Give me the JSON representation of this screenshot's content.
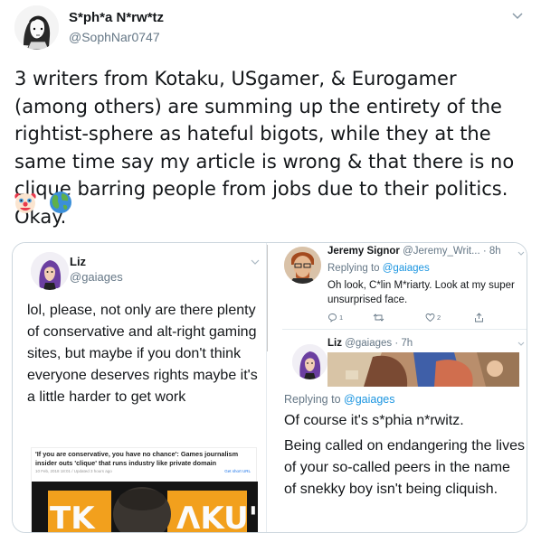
{
  "tweet": {
    "author_name": "S*ph*a N*rw*tz",
    "author_handle": "@SophNar0747",
    "text": "3 writers from Kotaku, USgamer, & Eurogamer (among others) are summing up the entirety of the rightist-sphere as hateful bigots, while they at the same time say my article is wrong & that there is no clique barring people from jobs due to their politics. Okay.",
    "emojis": [
      "clown-face-icon",
      "globe-icon"
    ]
  },
  "media": {
    "left": {
      "name": "Liz",
      "handle": "@gaiages",
      "text": "lol, please, not only are there plenty of conservative and alt-right gaming sites, but maybe if you don't think everyone deserves rights maybe it's a little harder to get work",
      "article": {
        "title": "'If you are conservative, you have no chance': Games journalism insider outs 'clique' that runs industry like private domain",
        "meta": "10 Feb, 2018 18:01 / Updated 3 hours ago",
        "share": "Get short URL",
        "logo_text": "TKOTAKU"
      }
    },
    "right": {
      "reply1": {
        "name": "Jeremy Signor",
        "handle_time": "@Jeremy_Writ... · 8h",
        "replying_label": "Replying to",
        "replying_to": "@gaiages",
        "text": "Oh look, C*lin M*riarty. Look at my super unsurprised face.",
        "replies": "1",
        "retweets": "",
        "likes": "2"
      },
      "reply2": {
        "name": "Liz",
        "handle_time": "@gaiages · 7h",
        "replying_label": "Replying to",
        "replying_to": "@gaiages",
        "text1": "Of course it's s*phia n*rwitz.",
        "text2": "Being called on endangering the lives of your so-called peers in the name of snekky boy isn't being cliquish."
      }
    }
  },
  "colors": {
    "link": "#1b95e0",
    "secondary_text": "#657786",
    "border": "#ccd6dd"
  }
}
